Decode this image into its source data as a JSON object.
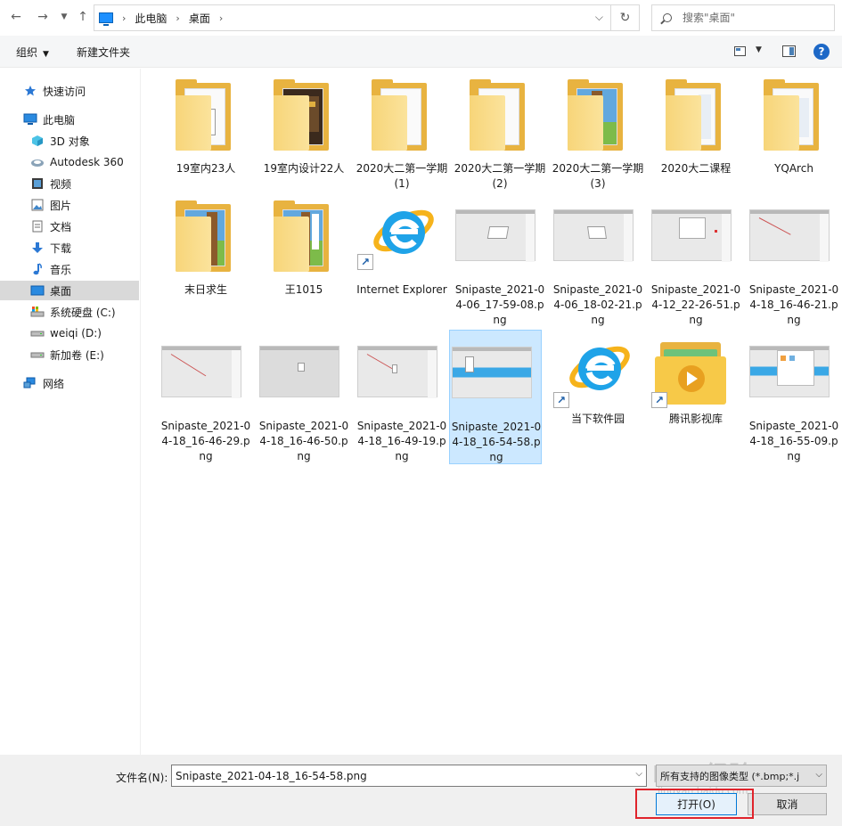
{
  "address": {
    "crumbs": [
      "此电脑",
      "桌面"
    ],
    "search_placeholder": "搜索\"桌面\""
  },
  "toolbar": {
    "organize": "组织",
    "new_folder": "新建文件夹"
  },
  "sidebar": {
    "items": [
      {
        "label": "快速访问",
        "icon": "star-icon"
      },
      {
        "label": "此电脑",
        "icon": "computer-icon"
      },
      {
        "label": "3D 对象",
        "icon": "cube-icon"
      },
      {
        "label": "Autodesk 360",
        "icon": "cloud-icon"
      },
      {
        "label": "视频",
        "icon": "video-icon"
      },
      {
        "label": "图片",
        "icon": "picture-icon"
      },
      {
        "label": "文档",
        "icon": "document-icon"
      },
      {
        "label": "下载",
        "icon": "download-icon"
      },
      {
        "label": "音乐",
        "icon": "music-icon"
      },
      {
        "label": "桌面",
        "icon": "desktop-icon"
      },
      {
        "label": "系统硬盘 (C:)",
        "icon": "drive-c-icon"
      },
      {
        "label": "weiqi (D:)",
        "icon": "drive-icon"
      },
      {
        "label": "新加卷 (E:)",
        "icon": "drive-icon"
      },
      {
        "label": "网络",
        "icon": "network-icon"
      }
    ]
  },
  "files": [
    {
      "name": "19室内23人",
      "kind": "folder"
    },
    {
      "name": "19室内设计22人",
      "kind": "folder"
    },
    {
      "name": "2020大二第一学期 (1)",
      "kind": "folder"
    },
    {
      "name": "2020大二第一学期 (2)",
      "kind": "folder"
    },
    {
      "name": "2020大二第一学期 (3)",
      "kind": "folder"
    },
    {
      "name": "2020大二课程",
      "kind": "folder"
    },
    {
      "name": "YQArch",
      "kind": "folder"
    },
    {
      "name": "末日求生",
      "kind": "folder"
    },
    {
      "name": "王1015",
      "kind": "folder"
    },
    {
      "name": "Internet Explorer",
      "kind": "ie"
    },
    {
      "name": "Snipaste_2021-04-06_17-59-08.png",
      "kind": "shot"
    },
    {
      "name": "Snipaste_2021-04-06_18-02-21.png",
      "kind": "shot"
    },
    {
      "name": "Snipaste_2021-04-12_22-26-51.png",
      "kind": "shot"
    },
    {
      "name": "Snipaste_2021-04-18_16-46-21.png",
      "kind": "shot"
    },
    {
      "name": "Snipaste_2021-04-18_16-46-29.png",
      "kind": "shot"
    },
    {
      "name": "Snipaste_2021-04-18_16-46-50.png",
      "kind": "shot"
    },
    {
      "name": "Snipaste_2021-04-18_16-49-19.png",
      "kind": "shot"
    },
    {
      "name": "Snipaste_2021-04-18_16-54-58.png",
      "kind": "shot",
      "selected": true
    },
    {
      "name": "当下软件园",
      "kind": "ie"
    },
    {
      "name": "腾讯影视库",
      "kind": "video-folder"
    },
    {
      "name": "Snipaste_2021-04-18_16-55-09.png",
      "kind": "shot"
    }
  ],
  "footer": {
    "filename_label": "文件名(N):",
    "filename_value": "Snipaste_2021-04-18_16-54-58.png",
    "filetype_value": "所有支持的图像类型 (*.bmp;*.j",
    "open_label": "打开(O)",
    "cancel_label": "取消"
  },
  "watermark": {
    "text": "Bai 经验",
    "sub": "jingyan.baidu.com"
  },
  "colors": {
    "accent": "#0078d7",
    "selection": "#cce8ff",
    "highlight_box": "#e0242c"
  }
}
